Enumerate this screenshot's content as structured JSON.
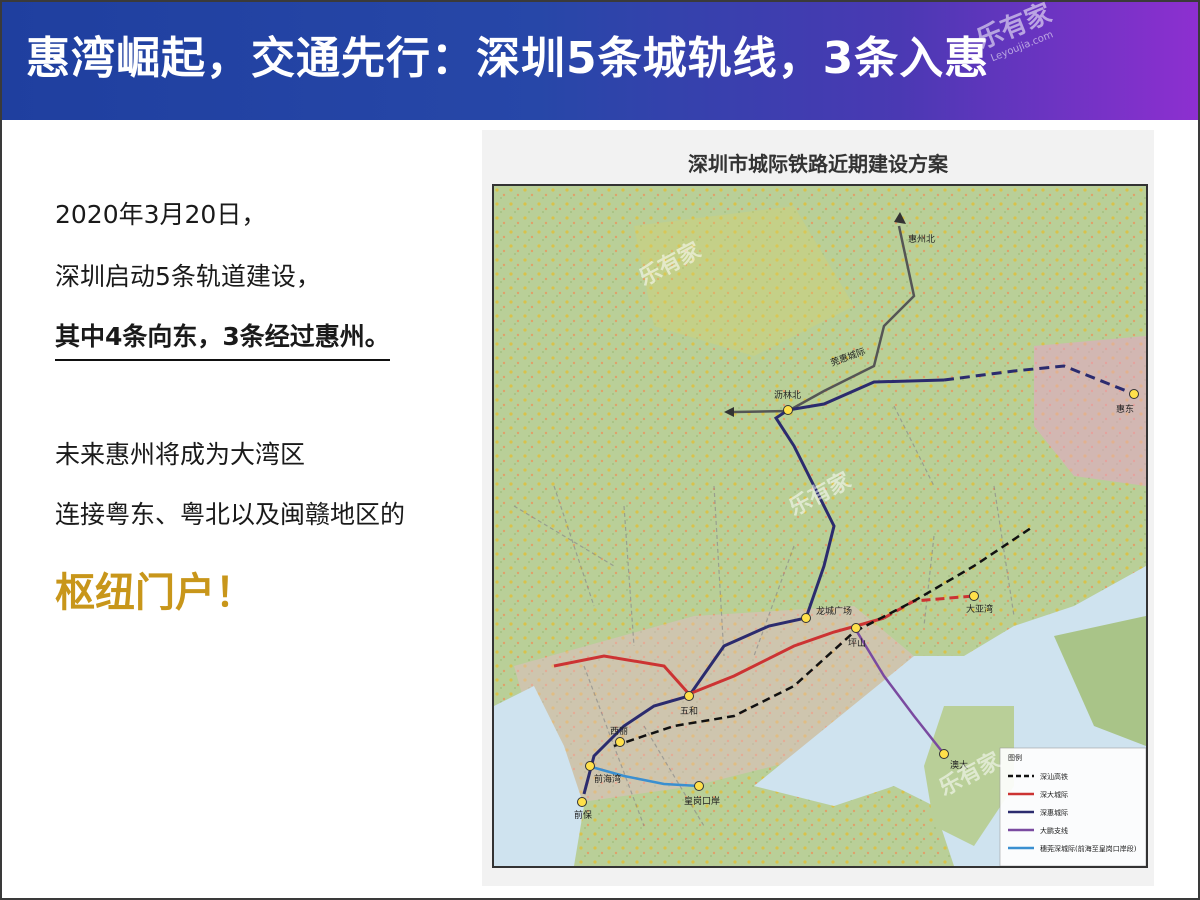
{
  "header": {
    "title": "惠湾崛起，交通先行：深圳5条城轨线，3条入惠",
    "watermark": "乐有家",
    "watermark_sub": "Leyoujia.com"
  },
  "left_panel": {
    "line1": "2020年3月20日，",
    "line2": "深圳启动5条轨道建设，",
    "line3": "其中4条向东，3条经过惠州。",
    "line4": "未来惠州将成为大湾区",
    "line5": "连接粤东、粤北以及闽赣地区的",
    "line6": "枢纽门户！",
    "accent_color": "#c8961a"
  },
  "map": {
    "title": "深圳市城际铁路近期建设方案",
    "stations": {
      "huizhoubei": "惠州北",
      "lilinbei": "沥林北",
      "huidong": "惠东",
      "longchengguangchang": "龙城广场",
      "pingshan": "坪山",
      "dayawan": "大亚湾",
      "wuhe": "五和",
      "xili": "西丽",
      "qianhaiwan": "前海湾",
      "qianbao": "前保",
      "huanggangkouan": "皇岗口岸",
      "aoda": "澳大"
    },
    "line_labels": {
      "guanhui": "莞惠城际"
    },
    "legend": {
      "title": "图例",
      "items": [
        {
          "label": "深汕高铁",
          "color": "#111111",
          "style": "dashed"
        },
        {
          "label": "深大城际",
          "color": "#cc3333",
          "style": "solid"
        },
        {
          "label": "深惠城际",
          "color": "#2b2b6e",
          "style": "solid"
        },
        {
          "label": "大鹏支线",
          "color": "#7a4aa0",
          "style": "solid"
        },
        {
          "label": "穗莞深城际(前海至皇岗口岸段)",
          "color": "#3a8fd0",
          "style": "solid"
        }
      ]
    }
  }
}
